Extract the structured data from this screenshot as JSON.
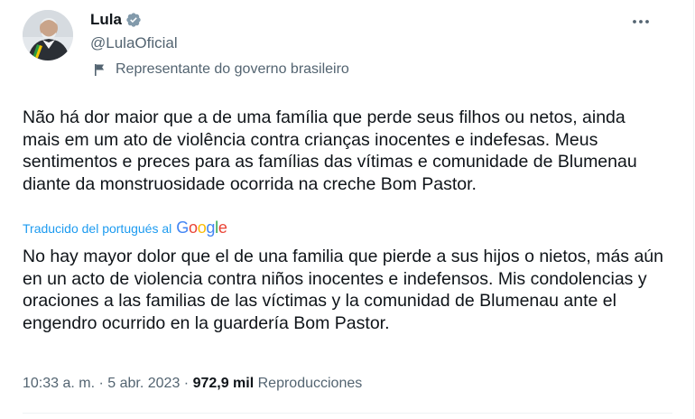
{
  "author": {
    "name": "Lula",
    "handle": "@LulaOficial",
    "affiliation_label": "Representante do governo brasileiro",
    "verified_color": "#829aab"
  },
  "tweet": {
    "text": "Não há dor maior que a de uma família que perde seus filhos ou netos, ainda mais em um ato de violência contra crianças inocentes e indefesas. Meus sentimentos e preces para as famílias das vítimas e comunidade de Blumenau diante da monstruosidade ocorrida na creche Bom Pastor.",
    "translated_label": "Traducido del portugués al",
    "translation_provider": "Google",
    "translation": "No hay mayor dolor que el de una familia que pierde a sus hijos o nietos, más aún en un acto de violencia contra niños inocentes e indefensos. Mis condolencias y oraciones a las familias de las víctimas y la comunidad de Blumenau ante el engendro ocurrido en la guardería Bom Pastor."
  },
  "meta": {
    "time": "10:33 a. m.",
    "separator": " · ",
    "date": "5 abr. 2023",
    "views_count": "972,9 mil",
    "views_label": "Reproducciones"
  },
  "icons": {
    "more": "more-horizontal-icon",
    "verified": "verified-badge-icon",
    "flag": "flag-icon"
  },
  "colors": {
    "text": "#0f1419",
    "secondary": "#536471",
    "link": "#1d9bf0"
  }
}
